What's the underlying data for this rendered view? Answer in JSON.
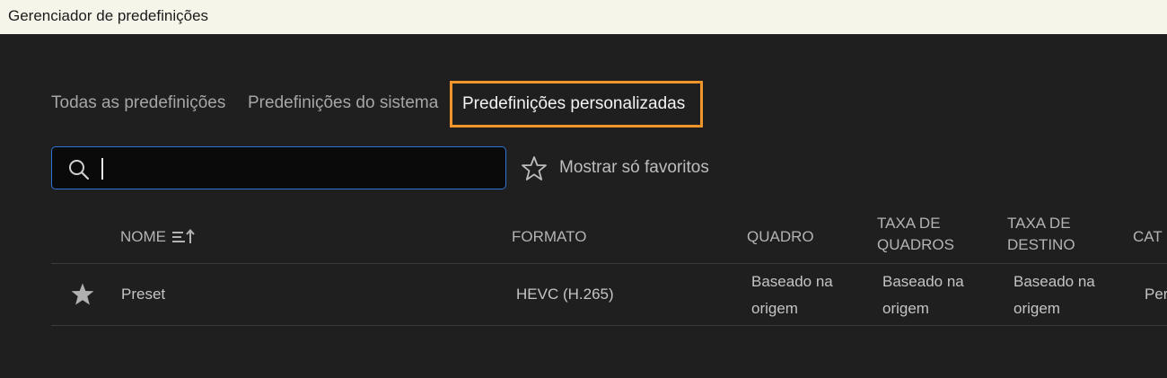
{
  "window": {
    "title": "Gerenciador de predefinições"
  },
  "tabs": [
    {
      "label": "Todas as predefinições",
      "selected": false
    },
    {
      "label": "Predefinições do sistema",
      "selected": false
    },
    {
      "label": "Predefinições personalizadas",
      "selected": true
    }
  ],
  "search": {
    "value": "",
    "placeholder": "",
    "icon": "search-icon"
  },
  "favorites_filter": {
    "label": "Mostrar só favoritos",
    "icon": "star-outline-icon"
  },
  "table": {
    "columns": {
      "nome": "NOME",
      "formato": "FORMATO",
      "quadro": "QUADRO",
      "taxa_quadros": "TAXA DE QUADROS",
      "taxa_destino": "TAXA DE DESTINO",
      "cat": "CAT"
    },
    "sort_icon": "sort-ascending-icon",
    "rows": [
      {
        "favorite": true,
        "name": "Preset",
        "format": "HEVC (H.265)",
        "frame": "Baseado na origem",
        "frame_rate": "Baseado na origem",
        "target_rate": "Baseado na origem",
        "category": "Per"
      }
    ]
  },
  "colors": {
    "background": "#1f1f1f",
    "titlebar": "#f6f5ea",
    "selected_tab_border": "#f0952b",
    "search_border": "#2f74d6"
  }
}
